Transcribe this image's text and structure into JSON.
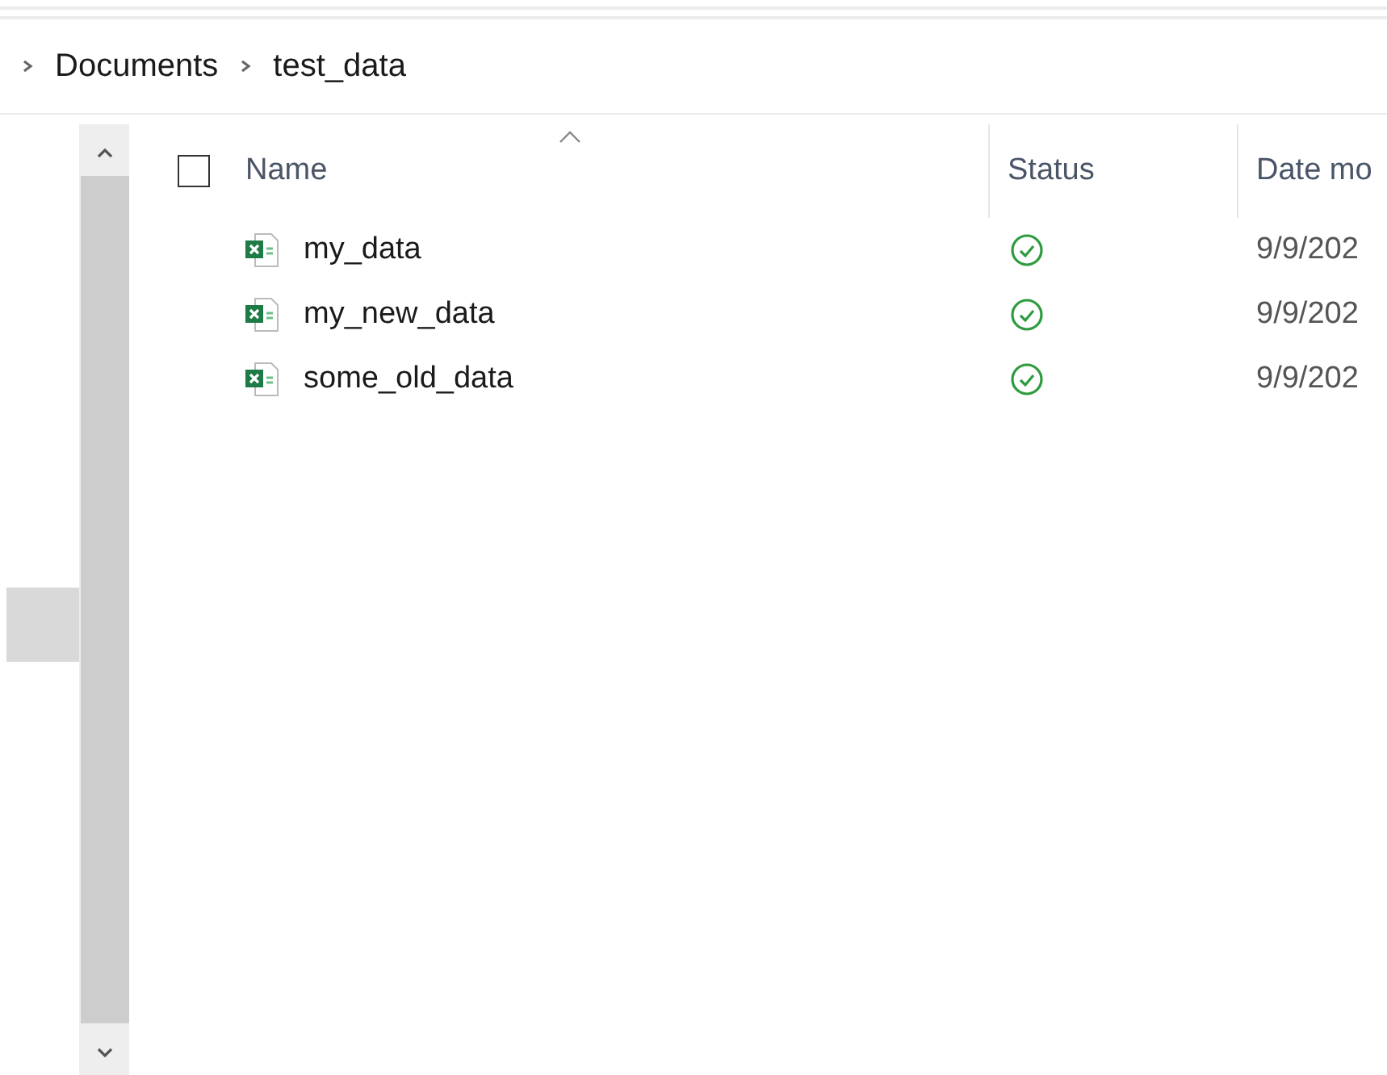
{
  "breadcrumb": [
    "Documents",
    "test_data"
  ],
  "columns": [
    {
      "label": "Name",
      "sorted": true
    },
    {
      "label": "Status",
      "sorted": false
    },
    {
      "label": "Date mo",
      "sorted": false
    }
  ],
  "select_all": {
    "checked": false
  },
  "rows": [
    {
      "name": "my_data",
      "synced": true,
      "date": "9/9/202"
    },
    {
      "name": "my_new_data",
      "synced": true,
      "date": "9/9/202"
    },
    {
      "name": "some_old_data",
      "synced": true,
      "date": "9/9/202"
    }
  ]
}
